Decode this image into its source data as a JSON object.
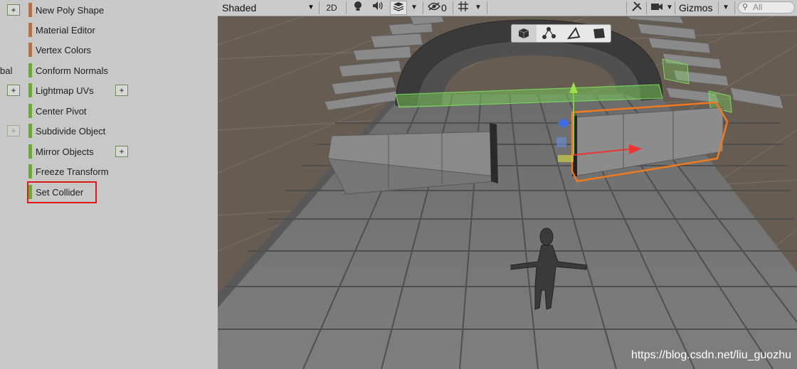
{
  "left_panel": {
    "cut_off_text": "bal",
    "items": [
      {
        "label": "New Poly Shape",
        "accent": "#b3734d",
        "plus_left": true,
        "plus_right": false
      },
      {
        "label": "Material Editor",
        "accent": "#b3734d",
        "plus_left": false,
        "plus_right": false
      },
      {
        "label": "Vertex Colors",
        "accent": "#b3734d",
        "plus_left": false,
        "plus_right": false
      },
      {
        "label": "Conform Normals",
        "accent": "#6fa83a",
        "plus_left": false,
        "plus_right": false
      },
      {
        "label": "Lightmap UVs",
        "accent": "#6fa83a",
        "plus_left": true,
        "plus_right": true
      },
      {
        "label": "Center Pivot",
        "accent": "#6fa83a",
        "plus_left": false,
        "plus_right": false
      },
      {
        "label": "Subdivide Object",
        "accent": "#6fa83a",
        "plus_left": true,
        "plus_right": false
      },
      {
        "label": "Mirror Objects",
        "accent": "#6fa83a",
        "plus_left": false,
        "plus_right": true
      },
      {
        "label": "Freeze Transform",
        "accent": "#6fa83a",
        "plus_left": false,
        "plus_right": false
      },
      {
        "label": "Set Collider",
        "accent": "#6fa83a",
        "plus_left": false,
        "plus_right": false,
        "highlighted": true
      }
    ],
    "plus_glyph": "+"
  },
  "toolbar": {
    "shading_mode": "Shaded",
    "mode_2d": "2D",
    "hidden_count": "0",
    "gizmos_label": "Gizmos",
    "search_placeholder": "All"
  },
  "scene": {
    "selection_outline_color": "#f07a1e",
    "collider_color": "#7bdc5a",
    "mode_buttons": [
      "object-mode-icon",
      "vertex-mode-icon",
      "edge-mode-icon",
      "face-mode-icon"
    ]
  },
  "watermark": "https://blog.csdn.net/liu_guozhu"
}
